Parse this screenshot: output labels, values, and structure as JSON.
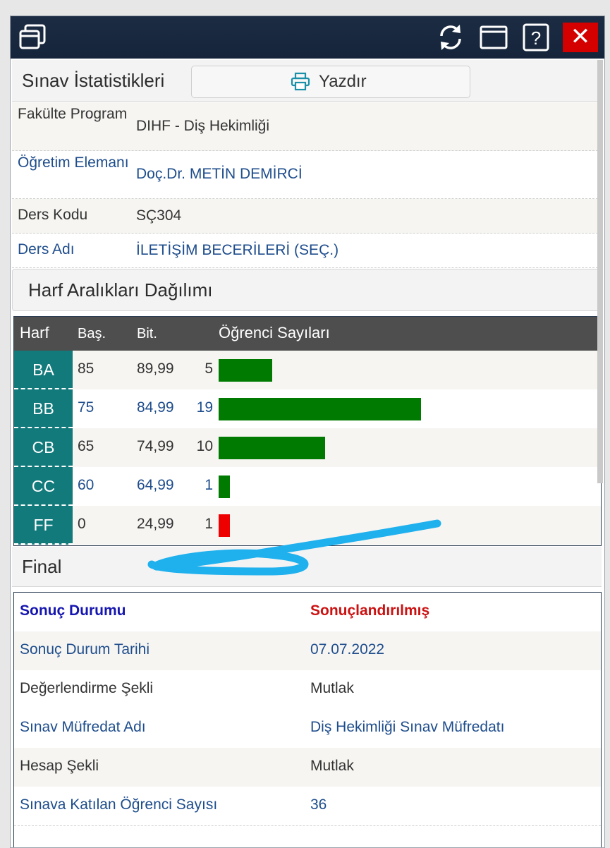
{
  "window": {
    "icons": [
      "windows-icon",
      "refresh-icon",
      "maximize-icon",
      "help-icon",
      "close-icon"
    ],
    "close_glyph": "✕",
    "help_glyph": "?"
  },
  "header": {
    "title": "Sınav İstatistikleri",
    "print_label": "Yazdır"
  },
  "info": [
    {
      "label": "Fakülte Program",
      "value": "DIHF - Diş Hekimliği",
      "color": "dark"
    },
    {
      "label": "Öğretim Elemanı",
      "value": "Doç.Dr. METİN DEMİRCİ",
      "color": "blue"
    },
    {
      "label": "Ders Kodu",
      "value": "SÇ304",
      "color": "dark"
    },
    {
      "label": "Ders Adı",
      "value": "İLETİŞİM BECERİLERİ (SEÇ.)",
      "color": "blue"
    }
  ],
  "distribution": {
    "title": "Harf Aralıkları Dağılımı",
    "columns": {
      "letter": "Harf",
      "start": "Baş.",
      "end": "Bit.",
      "students": "Öğrenci Sayıları"
    },
    "rows": [
      {
        "letter": "BA",
        "start": "85",
        "end": "89,99",
        "count": 5,
        "bar_color": "#007a00"
      },
      {
        "letter": "BB",
        "start": "75",
        "end": "84,99",
        "count": 19,
        "bar_color": "#007a00"
      },
      {
        "letter": "CB",
        "start": "65",
        "end": "74,99",
        "count": 10,
        "bar_color": "#007a00"
      },
      {
        "letter": "CC",
        "start": "60",
        "end": "64,99",
        "count": 1,
        "bar_color": "#007a00"
      },
      {
        "letter": "FF",
        "start": "0",
        "end": "24,99",
        "count": 1,
        "bar_color": "#ee0000"
      }
    ]
  },
  "final": {
    "title": "Final",
    "rows": [
      {
        "label": "Sonuç Durumu",
        "value": "Sonuçlandırılmış"
      },
      {
        "label": "Sonuç Durum Tarihi",
        "value": "07.07.2022"
      },
      {
        "label": "Değerlendirme Şekli",
        "value": "Mutlak"
      },
      {
        "label": "Sınav Müfredat Adı",
        "value": "Diş Hekimliği Sınav Müfredatı"
      },
      {
        "label": "Hesap Şekli",
        "value": "Mutlak"
      },
      {
        "label": "Sınava Katılan Öğrenci Sayısı",
        "value": "36"
      }
    ]
  },
  "colors": {
    "titlebar": "#1a2a40",
    "letter_cell": "#137a7c",
    "accent_blue": "#1e4d8c",
    "status_red": "#cc1111",
    "annotation_scribble": "#1fb0ee"
  }
}
